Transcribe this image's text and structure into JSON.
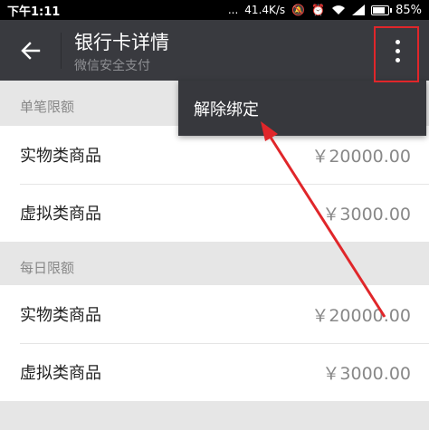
{
  "status_bar": {
    "time": "下午1:11",
    "dots": "...",
    "speed": "41.4K/s",
    "battery": "85%",
    "battery_level": 0.85
  },
  "header": {
    "title": "银行卡详情",
    "subtitle": "微信安全支付"
  },
  "menu": {
    "unbind_label": "解除绑定"
  },
  "sections": [
    {
      "title": "单笔限额",
      "rows": [
        {
          "label": "实物类商品",
          "amount": "￥20000.00"
        },
        {
          "label": "虚拟类商品",
          "amount": "￥3000.00"
        }
      ]
    },
    {
      "title": "每日限额",
      "rows": [
        {
          "label": "实物类商品",
          "amount": "￥20000.00"
        },
        {
          "label": "虚拟类商品",
          "amount": "￥3000.00"
        }
      ]
    }
  ],
  "colors": {
    "app_bar": "#393a3f",
    "popup": "#37383d",
    "annotation": "#e0262a",
    "background": "#e6e6e6"
  }
}
